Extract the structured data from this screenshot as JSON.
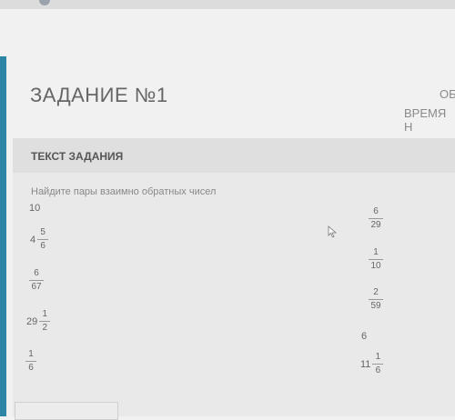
{
  "header": {
    "task_title": "ЗАДАНИЕ №1",
    "right_line1": "ОБ",
    "right_line2": "ВРЕМЯ Н"
  },
  "panel": {
    "header_label": "ТЕКСТ ЗАДАНИЯ",
    "instruction": "Найдите пары взаимно обратных чисел"
  },
  "left_items": [
    {
      "type": "integer",
      "text": "10"
    },
    {
      "type": "mixed",
      "whole": "4",
      "num": "5",
      "den": "6"
    },
    {
      "type": "fraction",
      "num": "6",
      "den": "67"
    },
    {
      "type": "mixed",
      "whole": "29",
      "num": "1",
      "den": "2"
    },
    {
      "type": "fraction",
      "num": "1",
      "den": "6"
    }
  ],
  "right_items": [
    {
      "type": "fraction",
      "num": "6",
      "den": "29"
    },
    {
      "type": "fraction",
      "num": "1",
      "den": "10"
    },
    {
      "type": "fraction",
      "num": "2",
      "den": "59"
    },
    {
      "type": "integer",
      "text": "6"
    },
    {
      "type": "mixed",
      "whole": "11",
      "num": "1",
      "den": "6"
    }
  ]
}
